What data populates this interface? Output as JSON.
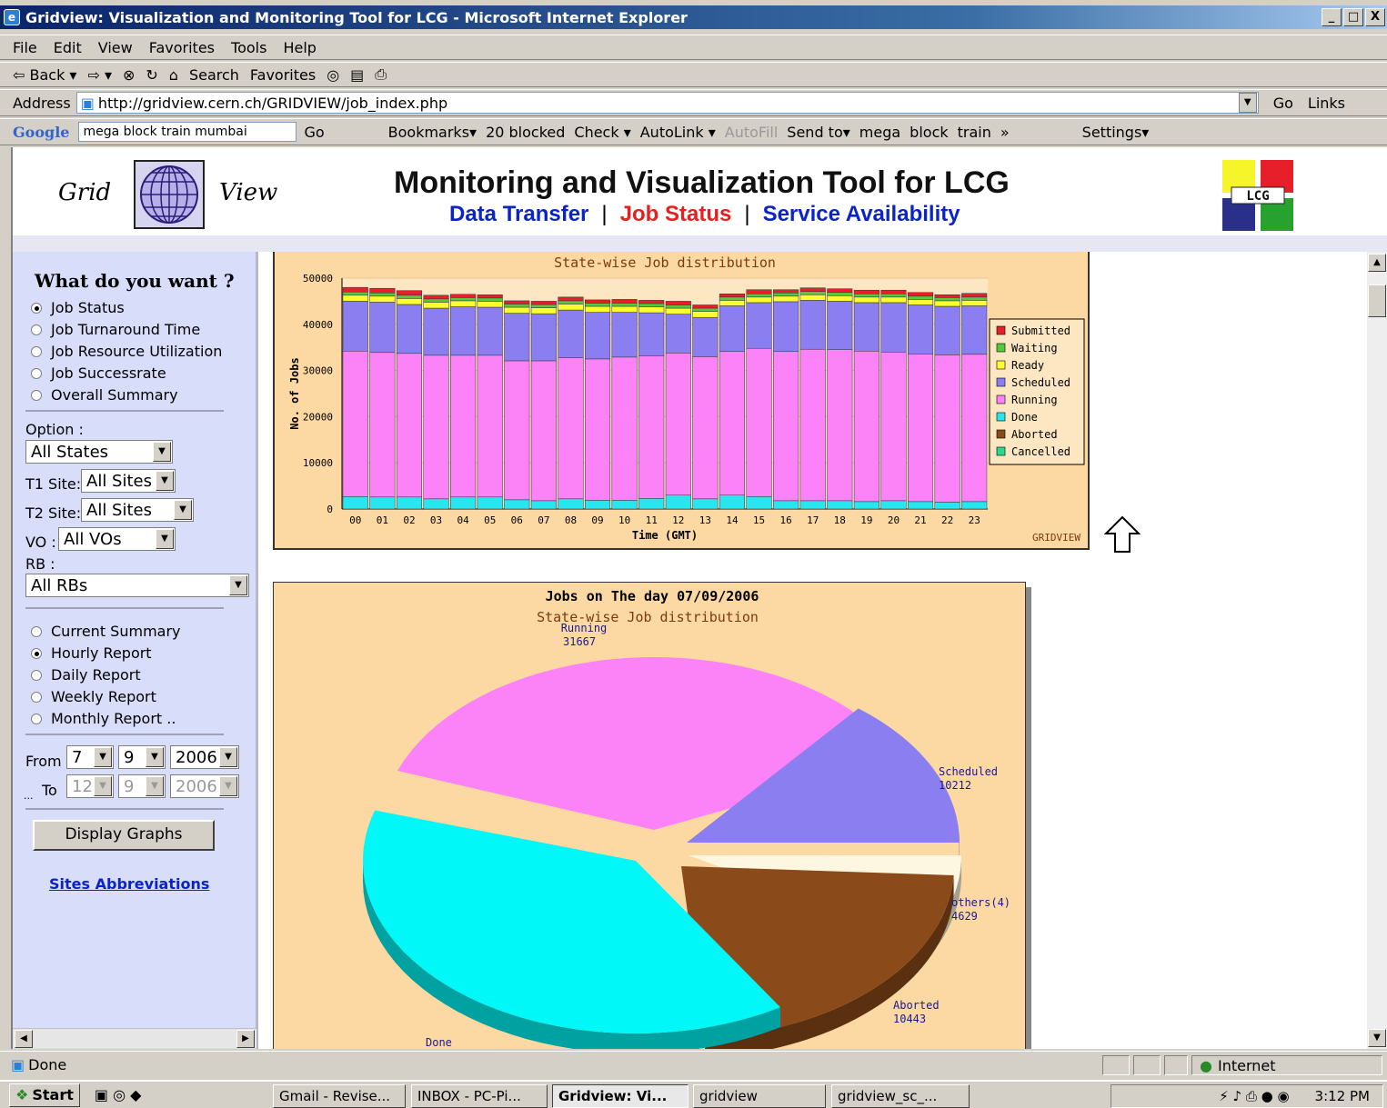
{
  "window": {
    "title": "Gridview: Visualization and Monitoring Tool for LCG - Microsoft Internet Explorer",
    "min": "_",
    "max": "□",
    "close": "X"
  },
  "menu": [
    "File",
    "Edit",
    "View",
    "Favorites",
    "Tools",
    "Help"
  ],
  "toolbar": {
    "back": "⇦ Back ▾",
    "fwd": "⇨ ▾",
    "search": "Search",
    "favorites": "Favorites"
  },
  "address": {
    "label": "Address",
    "url": "http://gridview.cern.ch/GRIDVIEW/job_index.php",
    "go": "Go",
    "links": "Links"
  },
  "google": {
    "logo": "Google",
    "query": "mega block train mumbai",
    "go": "Go",
    "bookmarks": "Bookmarks▾",
    "blocked": "20 blocked",
    "check": "Check ▾",
    "autolink": "AutoLink ▾",
    "autofill": "AutoFill",
    "sendto": "Send to▾",
    "w1": "mega",
    "w2": "block",
    "w3": "train",
    "more": "»",
    "settings": "Settings▾"
  },
  "header": {
    "logo_left": "Grid",
    "logo_right": "View",
    "title": "Monitoring and Visualization Tool for LCG",
    "nav": [
      "Data Transfer",
      "Job Status",
      "Service Availability"
    ],
    "sep": "|",
    "lcg": "LCG"
  },
  "sidebar": {
    "question": "What do you want ?",
    "metrics": [
      "Job Status",
      "Job Turnaround Time",
      "Job Resource Utilization",
      "Job Successrate",
      "Overall Summary"
    ],
    "option_label": "Option :",
    "option_value": "All States",
    "t1_label": "T1 Site:",
    "t1_value": "All Sites",
    "t2_label": "T2 Site:",
    "t2_value": "All Sites",
    "vo_label": "VO :",
    "vo_value": "All VOs",
    "rb_label": "RB :",
    "rb_value": "All RBs",
    "reports": [
      "Current Summary",
      "Hourly Report",
      "Daily Report",
      "Weekly Report",
      "Monthly Report .."
    ],
    "from_label": "From",
    "from": [
      "7",
      "9",
      "2006"
    ],
    "to_label": "To",
    "to": [
      "12",
      "9",
      "2006"
    ],
    "dots": "...",
    "button": "Display Graphs",
    "link": "Sites Abbreviations"
  },
  "colors": {
    "Submitted": "#e61f2a",
    "Waiting": "#56c83c",
    "Ready": "#fcfc30",
    "Scheduled": "#8a7ef0",
    "Running": "#fc82f8",
    "Done": "#27e6f0",
    "Aborted": "#8a4a1a",
    "Cancelled": "#2ad890"
  },
  "chart_data": [
    {
      "type": "bar",
      "title": "State-wise Job distribution",
      "xlabel": "Time (GMT)",
      "ylabel": "No. of Jobs",
      "ylim": [
        0,
        50000
      ],
      "yticks": [
        0,
        10000,
        20000,
        30000,
        40000,
        50000
      ],
      "stacked": true,
      "legend": "right",
      "watermark": "GRIDVIEW",
      "categories": [
        "00",
        "01",
        "02",
        "03",
        "04",
        "05",
        "06",
        "07",
        "08",
        "09",
        "10",
        "11",
        "12",
        "13",
        "14",
        "15",
        "16",
        "17",
        "18",
        "19",
        "20",
        "21",
        "22",
        "23"
      ],
      "series": [
        {
          "name": "Done",
          "values": [
            2700,
            2600,
            2600,
            2200,
            2600,
            2600,
            2000,
            1800,
            2200,
            1900,
            1900,
            2300,
            3000,
            2200,
            3000,
            2700,
            1800,
            1800,
            1800,
            1600,
            1800,
            1600,
            1500,
            1600
          ]
        },
        {
          "name": "Running",
          "values": [
            31500,
            31300,
            31100,
            31100,
            30700,
            30700,
            30100,
            30300,
            30600,
            30600,
            31000,
            30900,
            30800,
            30800,
            31100,
            32100,
            32300,
            32800,
            32700,
            32600,
            32200,
            32000,
            31900,
            31900
          ]
        },
        {
          "name": "Scheduled",
          "values": [
            10800,
            10900,
            10600,
            10200,
            10500,
            10400,
            10300,
            10200,
            10300,
            10100,
            9700,
            9300,
            8400,
            8500,
            9900,
            9900,
            10800,
            10600,
            10500,
            10500,
            10700,
            10600,
            10500,
            10500
          ]
        },
        {
          "name": "Ready",
          "values": [
            1300,
            1300,
            1300,
            1300,
            1300,
            1300,
            1300,
            1300,
            1300,
            1300,
            1300,
            1300,
            1300,
            1300,
            1200,
            1200,
            1200,
            1200,
            1200,
            1200,
            1200,
            1200,
            1200,
            1200
          ]
        },
        {
          "name": "Waiting",
          "values": [
            700,
            700,
            700,
            700,
            700,
            700,
            700,
            700,
            700,
            700,
            700,
            700,
            700,
            700,
            700,
            700,
            700,
            700,
            700,
            700,
            700,
            700,
            700,
            700
          ]
        },
        {
          "name": "Submitted",
          "values": [
            1000,
            1000,
            1000,
            800,
            700,
            700,
            700,
            700,
            800,
            700,
            800,
            700,
            800,
            700,
            700,
            900,
            700,
            800,
            800,
            800,
            800,
            800,
            600,
            800
          ]
        },
        {
          "name": "Aborted",
          "values": [
            0,
            0,
            0,
            0,
            0,
            0,
            0,
            0,
            0,
            0,
            0,
            0,
            0,
            0,
            0,
            0,
            0,
            0,
            0,
            0,
            0,
            0,
            0,
            0
          ]
        },
        {
          "name": "Cancelled",
          "values": [
            0,
            0,
            0,
            0,
            0,
            0,
            0,
            0,
            0,
            0,
            0,
            0,
            0,
            0,
            0,
            0,
            0,
            0,
            0,
            0,
            0,
            0,
            0,
            0
          ]
        }
      ]
    },
    {
      "type": "pie",
      "title": "Jobs on The day   07/09/2006",
      "subtitle": "State-wise Job distribution",
      "slices": [
        {
          "name": "Running",
          "value": 31667,
          "color": "#fc82f8"
        },
        {
          "name": "Scheduled",
          "value": 10212,
          "color": "#8a7ef0"
        },
        {
          "name": "others(4)",
          "value": 4629,
          "color": "#fdf6e0"
        },
        {
          "name": "Aborted",
          "value": 10443,
          "color": "#8a4a1a"
        },
        {
          "name": "Done",
          "value": null,
          "color": "#00f8f8"
        }
      ]
    }
  ],
  "status": {
    "text": "Done",
    "zone": "Internet"
  },
  "taskbar": {
    "start": "Start",
    "tasks": [
      "Gmail - Revise...",
      "INBOX - PC-Pi...",
      "Gridview: Vi...",
      "gridview",
      "gridview_sc_..."
    ],
    "time": "3:12 PM"
  }
}
